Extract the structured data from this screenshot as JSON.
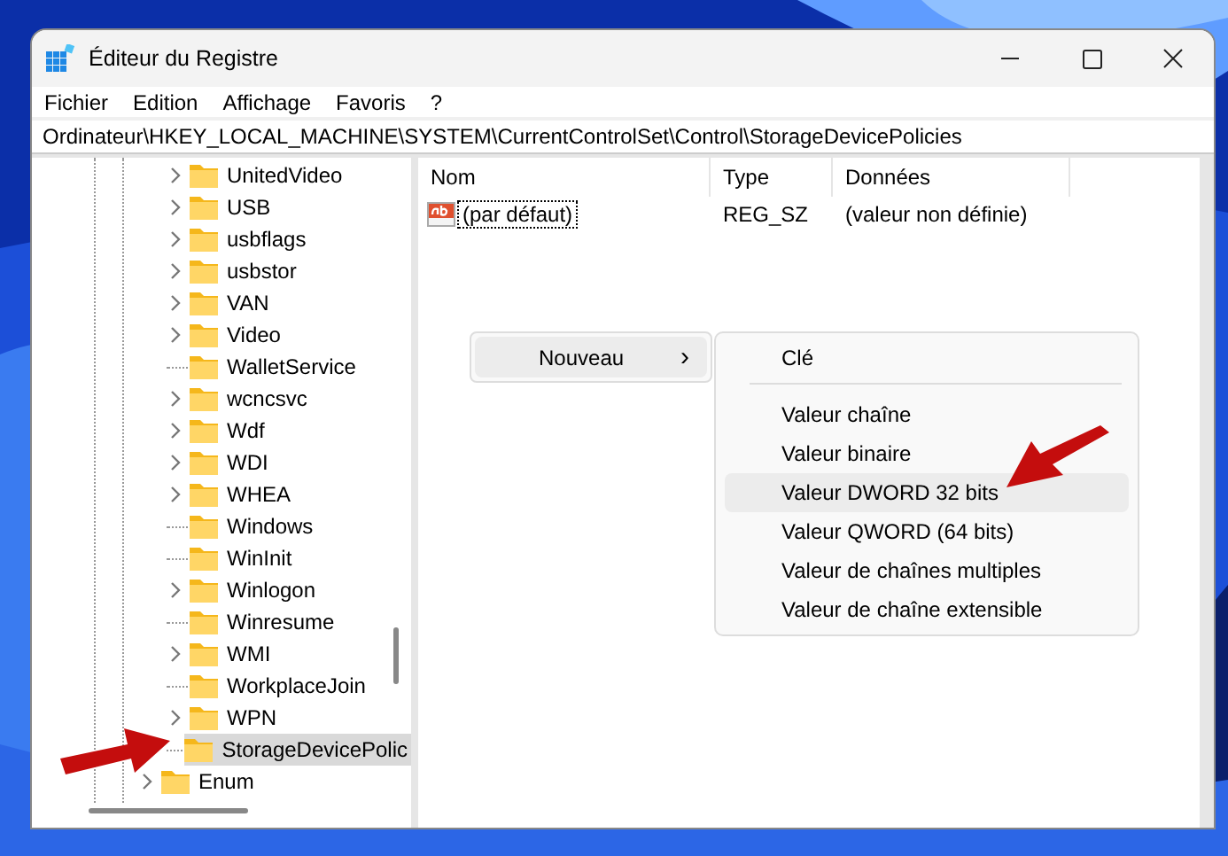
{
  "window": {
    "title": "Éditeur du Registre"
  },
  "menu_bar": [
    "Fichier",
    "Edition",
    "Affichage",
    "Favoris",
    "?"
  ],
  "address": "Ordinateur\\HKEY_LOCAL_MACHINE\\SYSTEM\\CurrentControlSet\\Control\\StorageDevicePolicies",
  "tree": [
    {
      "children": [
        {
          "name": "UnitedVideo",
          "expandable": true,
          "selected": false
        },
        {
          "name": "USB",
          "expandable": true,
          "selected": false
        },
        {
          "name": "usbflags",
          "expandable": true,
          "selected": false
        },
        {
          "name": "usbstor",
          "expandable": true,
          "selected": false
        },
        {
          "name": "VAN",
          "expandable": true,
          "selected": false
        },
        {
          "name": "Video",
          "expandable": true,
          "selected": false
        },
        {
          "name": "WalletService",
          "expandable": false,
          "selected": false
        },
        {
          "name": "wcncsvc",
          "expandable": true,
          "selected": false
        },
        {
          "name": "Wdf",
          "expandable": true,
          "selected": false
        },
        {
          "name": "WDI",
          "expandable": true,
          "selected": false
        },
        {
          "name": "WHEA",
          "expandable": true,
          "selected": false
        },
        {
          "name": "Windows",
          "expandable": false,
          "selected": false
        },
        {
          "name": "WinInit",
          "expandable": false,
          "selected": false
        },
        {
          "name": "Winlogon",
          "expandable": true,
          "selected": false
        },
        {
          "name": "Winresume",
          "expandable": false,
          "selected": false
        },
        {
          "name": "WMI",
          "expandable": true,
          "selected": false
        },
        {
          "name": "WorkplaceJoin",
          "expandable": false,
          "selected": false
        },
        {
          "name": "WPN",
          "expandable": true,
          "selected": false
        },
        {
          "name": "StorageDevicePolic",
          "expandable": false,
          "selected": true
        }
      ]
    },
    {
      "name": "Enum",
      "expandable": true,
      "selected": false
    }
  ],
  "table": {
    "columns": [
      "Nom",
      "Type",
      "Données"
    ],
    "rows": [
      {
        "name": "(par défaut)",
        "type": "REG_SZ",
        "data": "(valeur non définie)",
        "focused": true
      }
    ]
  },
  "context_menu": {
    "label": "Nouveau",
    "arrow": "›",
    "highlighted": true,
    "submenu": [
      {
        "label": "Clé",
        "kind": "item",
        "highlighted": false
      },
      {
        "kind": "separator"
      },
      {
        "label": "Valeur chaîne",
        "kind": "item",
        "highlighted": false
      },
      {
        "label": "Valeur binaire",
        "kind": "item",
        "highlighted": false
      },
      {
        "label": "Valeur DWORD 32 bits",
        "kind": "item",
        "highlighted": true
      },
      {
        "label": "Valeur QWORD (64 bits)",
        "kind": "item",
        "highlighted": false
      },
      {
        "label": "Valeur de chaînes multiples",
        "kind": "item",
        "highlighted": false
      },
      {
        "label": "Valeur de chaîne extensible",
        "kind": "item",
        "highlighted": false
      }
    ]
  }
}
